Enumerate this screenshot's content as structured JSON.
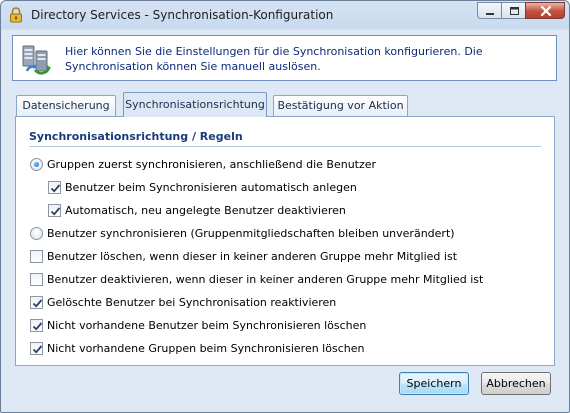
{
  "window": {
    "title": "Directory Services - Synchronisation-Konfiguration",
    "controls": [
      "minimize",
      "maximize",
      "close"
    ]
  },
  "info": {
    "icon": "sync-servers-icon",
    "text": "Hier können Sie die Einstellungen für die Synchronisation konfigurieren. Die Synchronisation können Sie manuell auslösen."
  },
  "tabs": [
    {
      "label": "Datensicherung",
      "active": false
    },
    {
      "label": "Synchronisationsrichtung",
      "active": true
    },
    {
      "label": "Bestätigung vor Aktion",
      "active": false
    }
  ],
  "section": {
    "title": "Synchronisationsrichtung / Regeln"
  },
  "options": [
    {
      "type": "radio",
      "label": "Gruppen zuerst synchronisieren, anschließend die Benutzer",
      "checked": true
    },
    {
      "type": "checkbox",
      "label": "Benutzer beim Synchronisieren automatisch anlegen",
      "checked": true
    },
    {
      "type": "checkbox",
      "label": "Automatisch, neu angelegte Benutzer deaktivieren",
      "checked": true
    },
    {
      "type": "radio",
      "label": "Benutzer synchronisieren (Gruppenmitgliedschaften bleiben unverändert)",
      "checked": false
    },
    {
      "type": "checkbox",
      "label": "Benutzer löschen, wenn dieser in keiner anderen Gruppe mehr Mitglied ist",
      "checked": false
    },
    {
      "type": "checkbox",
      "label": "Benutzer deaktivieren, wenn dieser in keiner anderen Gruppe mehr Mitglied ist",
      "checked": false
    },
    {
      "type": "checkbox",
      "label": "Gelöschte Benutzer bei Synchronisation reaktivieren",
      "checked": true
    },
    {
      "type": "checkbox",
      "label": "Nicht vorhandene Benutzer beim Synchronisieren löschen",
      "checked": true
    },
    {
      "type": "checkbox",
      "label": "Nicht vorhandene Gruppen beim Synchronisieren löschen",
      "checked": true
    }
  ],
  "buttons": {
    "save": "Speichern",
    "cancel": "Abbrechen"
  },
  "colors": {
    "accent": "#1a3b7a",
    "info_text": "#0d2a7a",
    "window_bg": "#dfe9f5"
  }
}
